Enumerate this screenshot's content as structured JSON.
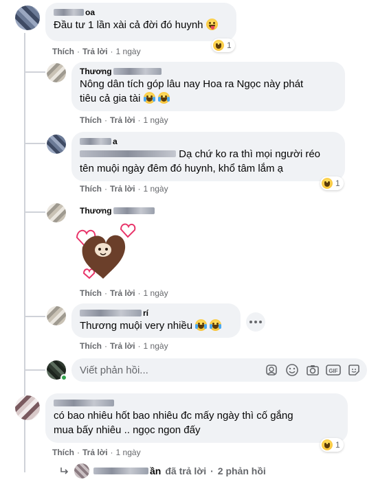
{
  "comments": [
    {
      "name_visible": "oa",
      "text": "Đầu tư 1 lần xài cả đời đó huynh",
      "actions": {
        "like": "Thích",
        "reply": "Trả lời",
        "time": "1 ngày"
      },
      "reaction_count": "1"
    },
    {
      "name_visible": "Thương",
      "text": "Nông dân tích góp lâu nay Hoa ra Ngọc này phát\ntiêu cả gia tài",
      "actions": {
        "like": "Thích",
        "reply": "Trả lời",
        "time": "1 ngày"
      }
    },
    {
      "name_visible": "a",
      "text": "Dạ chứ ko ra thì mọi người réo\ntên muội ngày đêm đó huynh, khổ tâm lắm ạ",
      "actions": {
        "like": "Thích",
        "reply": "Trả lời",
        "time": "1 ngày"
      },
      "reaction_count": "1"
    },
    {
      "name_visible": "Thương",
      "actions": {
        "like": "Thích",
        "reply": "Trả lời",
        "time": "1 ngày"
      }
    },
    {
      "name_visible": "rí",
      "text": "Thương muội very nhiều",
      "actions": {
        "like": "Thích",
        "reply": "Trả lời",
        "time": "1 ngày"
      }
    },
    {
      "name_visible": "",
      "text": "có bao nhiêu hốt bao nhiêu đc mấy ngày thì cố gắng\nmua bấy nhiêu .. ngọc ngon đấy",
      "actions": {
        "like": "Thích",
        "reply": "Trả lời",
        "time": "1 ngày"
      },
      "reaction_count": "1"
    }
  ],
  "reply_input": {
    "placeholder": "Viết phản hồi..."
  },
  "replies_summary": {
    "name_tail": "ần",
    "text": "đã trả lời",
    "count": "2 phản hồi"
  },
  "colors": {
    "bubble": "#f0f2f5",
    "meta": "#65676b",
    "online": "#31a24c"
  }
}
